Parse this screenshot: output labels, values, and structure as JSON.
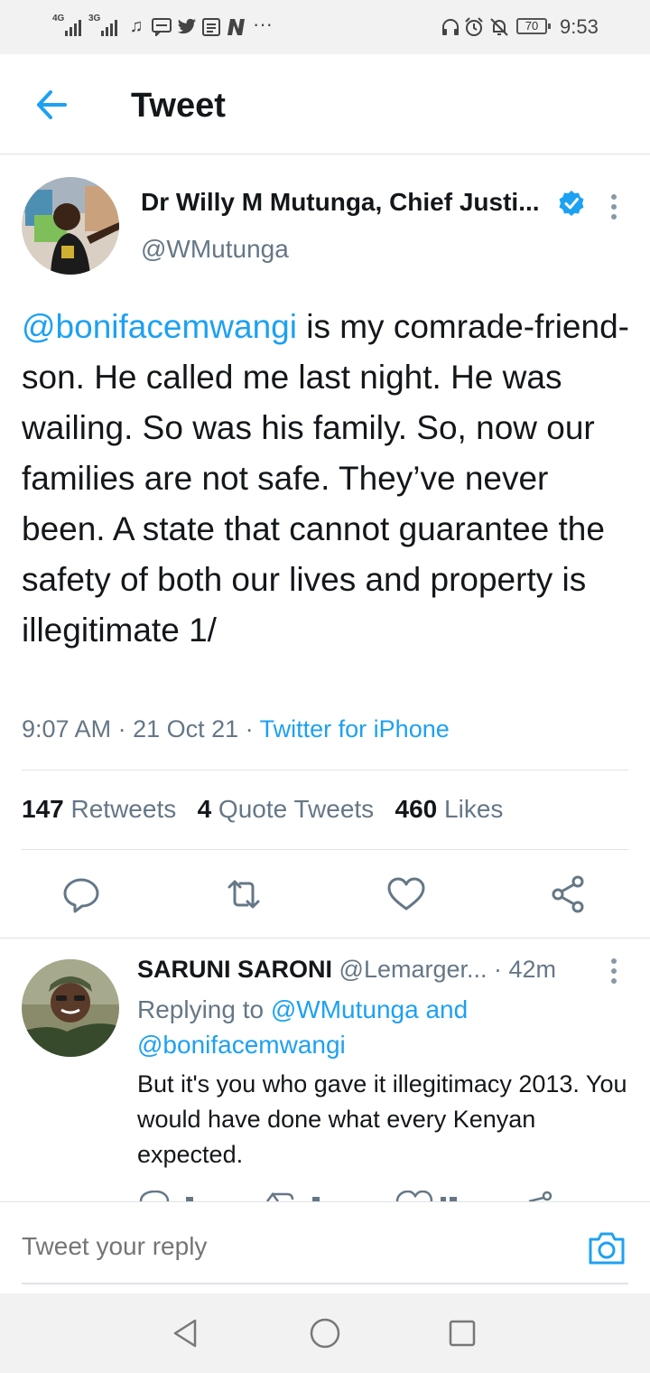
{
  "status_bar": {
    "signal1_tag": "4G",
    "signal2_tag": "3G",
    "battery": "70",
    "time": "9:53",
    "more": "···",
    "icons": [
      "signal-4g-icon",
      "signal-3g-icon",
      "music-note-icon",
      "message-icon",
      "twitter-bird-icon",
      "news-icon",
      "n-app-icon",
      "headphones-icon",
      "alarm-icon",
      "silent-bell-icon",
      "battery-icon"
    ]
  },
  "header": {
    "title": "Tweet",
    "back_icon": "back-arrow-icon"
  },
  "tweet": {
    "author_name": "Dr Willy M Mutunga, Chief Justi...",
    "handle": "@WMutunga",
    "mention": "@bonifacemwangi",
    "text_after_mention": " is my comrade-friend-son. He called me last night. He was wailing. So was his family. So, now our families are not safe. They’ve never been. A state that cannot guarantee the safety of both our  lives and property  is illegitimate 1/",
    "time": "9:07 AM",
    "date": "21 Oct 21",
    "source": "Twitter for iPhone",
    "stats": {
      "retweets_count": "147",
      "retweets_label": "Retweets",
      "quotes_count": "4",
      "quotes_label": "Quote Tweets",
      "likes_count": "460",
      "likes_label": "Likes"
    },
    "actions": [
      "reply-icon",
      "retweet-icon",
      "like-icon",
      "share-icon"
    ]
  },
  "reply": {
    "author_name": "SARUNI SARONI",
    "handle": "@Lemarger...",
    "age": "· 42m",
    "replying_prefix": "Replying to ",
    "replying_to_1": "@WMutunga",
    "replying_and": " and",
    "replying_to_2": "@bonifacemwangi",
    "text": "But it's you who gave it illegitimacy 2013. You would have done what every Kenyan expected."
  },
  "compose": {
    "placeholder": "Tweet your reply",
    "camera_icon": "camera-icon"
  },
  "nav_bar": {
    "buttons": [
      "nav-back-icon",
      "nav-home-icon",
      "nav-recents-icon"
    ]
  },
  "colors": {
    "accent": "#1da1f2",
    "text_primary": "#14171a",
    "text_secondary": "#657786",
    "divider": "#dfe3e6"
  }
}
